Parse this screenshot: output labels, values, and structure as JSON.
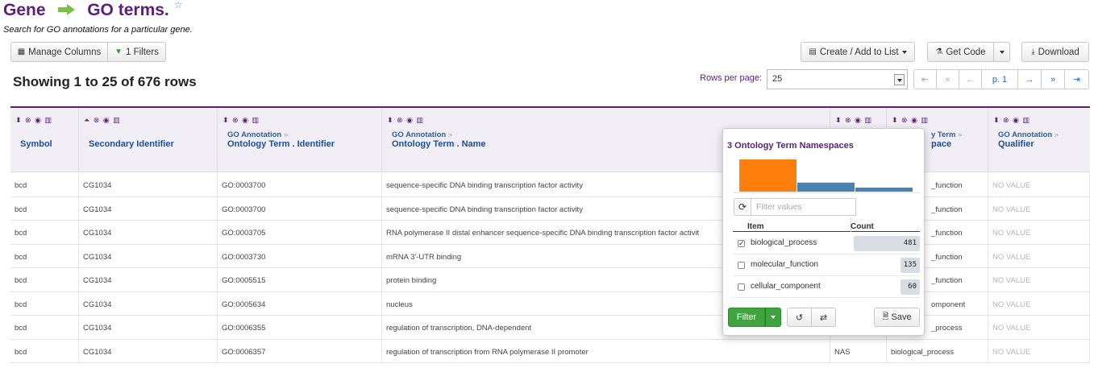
{
  "header": {
    "title_left": "Gene",
    "title_right": "GO terms.",
    "subtitle": "Search for GO annotations for a particular gene."
  },
  "toolbar": {
    "manage_columns": "Manage Columns",
    "filters": "1 Filters",
    "create_list": "Create / Add to List",
    "get_code": "Get Code",
    "download": "Download"
  },
  "summary": {
    "showing": "Showing 1 to 25 of 676 rows",
    "rows_per_page_label": "Rows per page:",
    "rows_per_page_value": "25"
  },
  "pager": {
    "first": "⇤",
    "prev_many": "«",
    "prev": "←",
    "page": "p. 1",
    "next": "→",
    "next_many": "»",
    "last": "⇥"
  },
  "columns": [
    {
      "crumb": "",
      "label": "Symbol"
    },
    {
      "crumb": "",
      "label": "Secondary Identifier"
    },
    {
      "crumb": "GO Annotation",
      "label": "Ontology Term . Identifier"
    },
    {
      "crumb": "GO Annotation",
      "label": "Ontology Term . Name"
    },
    {
      "crumb": "",
      "label": ""
    },
    {
      "crumb": "y Term",
      "label": "pace"
    },
    {
      "crumb": "GO Annotation",
      "label": "Qualifier"
    }
  ],
  "rows": [
    {
      "symbol": "bcd",
      "secondary": "CG1034",
      "go_id": "GO:0003700",
      "name": "sequence-specific DNA binding transcription factor activity",
      "evidence": "",
      "namespace": "_function",
      "qualifier": "NO VALUE"
    },
    {
      "symbol": "bcd",
      "secondary": "CG1034",
      "go_id": "GO:0003700",
      "name": "sequence-specific DNA binding transcription factor activity",
      "evidence": "",
      "namespace": "_function",
      "qualifier": "NO VALUE"
    },
    {
      "symbol": "bcd",
      "secondary": "CG1034",
      "go_id": "GO:0003705",
      "name": "RNA polymerase II distal enhancer sequence-specific DNA binding transcription factor activit",
      "evidence": "",
      "namespace": "_function",
      "qualifier": "NO VALUE"
    },
    {
      "symbol": "bcd",
      "secondary": "CG1034",
      "go_id": "GO:0003730",
      "name": "mRNA 3'-UTR binding",
      "evidence": "",
      "namespace": "_function",
      "qualifier": "NO VALUE"
    },
    {
      "symbol": "bcd",
      "secondary": "CG1034",
      "go_id": "GO:0005515",
      "name": "protein binding",
      "evidence": "",
      "namespace": "_function",
      "qualifier": "NO VALUE"
    },
    {
      "symbol": "bcd",
      "secondary": "CG1034",
      "go_id": "GO:0005634",
      "name": "nucleus",
      "evidence": "",
      "namespace": "omponent",
      "qualifier": "NO VALUE"
    },
    {
      "symbol": "bcd",
      "secondary": "CG1034",
      "go_id": "GO:0006355",
      "name": "regulation of transcription, DNA-dependent",
      "evidence": "",
      "namespace": "_process",
      "qualifier": "NO VALUE"
    },
    {
      "symbol": "bcd",
      "secondary": "CG1034",
      "go_id": "GO:0006357",
      "name": "regulation of transcription from RNA polymerase II promoter",
      "evidence": "NAS",
      "namespace": "biological_process",
      "qualifier": "NO VALUE"
    }
  ],
  "popup": {
    "title": "3 Ontology Term Namespaces",
    "filter_placeholder": "Filter values",
    "col_item": "Item",
    "col_count": "Count",
    "items": [
      {
        "name": "biological_process",
        "count": "481",
        "checked": true
      },
      {
        "name": "molecular_function",
        "count": "135",
        "checked": false
      },
      {
        "name": "cellular_component",
        "count": "60",
        "checked": false
      }
    ],
    "filter_button": "Filter",
    "save_button": "Save",
    "colors": {
      "highlight": "#ff7f0e",
      "bar": "#4682b4"
    }
  },
  "chart_data": {
    "type": "bar",
    "categories": [
      "biological_process",
      "molecular_function",
      "cellular_component"
    ],
    "values": [
      481,
      135,
      60
    ]
  },
  "colors": {
    "brand": "#5b1f7a",
    "link": "#1a4f96",
    "accent_green": "#3fa33f"
  }
}
